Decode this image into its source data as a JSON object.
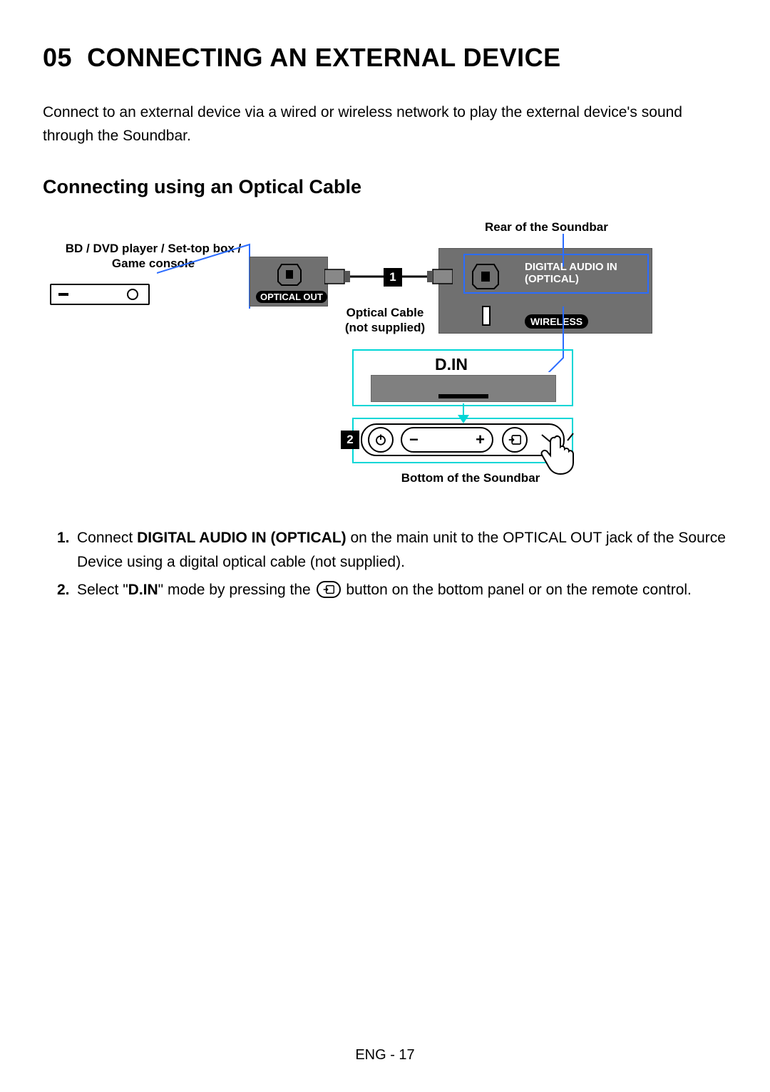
{
  "section_number": "05",
  "title": "CONNECTING AN EXTERNAL DEVICE",
  "intro": "Connect to an external device via a wired or wireless network to play the external device's sound through the Soundbar.",
  "subtitle": "Connecting using an Optical Cable",
  "labels": {
    "rear": "Rear of the Soundbar",
    "source_device": "BD / DVD player / Set-top box /\nGame console",
    "optical_out": "OPTICAL OUT",
    "optical_cable_1": "Optical Cable",
    "optical_cable_2": "(not supplied)",
    "din": "D.IN",
    "digital_in_1": "DIGITAL AUDIO IN",
    "digital_in_2": "(OPTICAL)",
    "wireless": "WIRELESS",
    "bottom": "Bottom of the Soundbar"
  },
  "badges": {
    "one": "1",
    "two": "2"
  },
  "steps": [
    {
      "num": "1.",
      "pre": "Connect ",
      "bold": "DIGITAL AUDIO IN (OPTICAL)",
      "post": " on the main unit to the OPTICAL OUT jack of the Source Device using a digital optical cable (not supplied)."
    },
    {
      "num": "2.",
      "pre": "Select \"",
      "bold": "D.IN",
      "post_pre_icon": "\" mode by pressing the ",
      "post_after_icon": " button on the bottom panel or on the remote control."
    }
  ],
  "footer": "ENG - 17"
}
